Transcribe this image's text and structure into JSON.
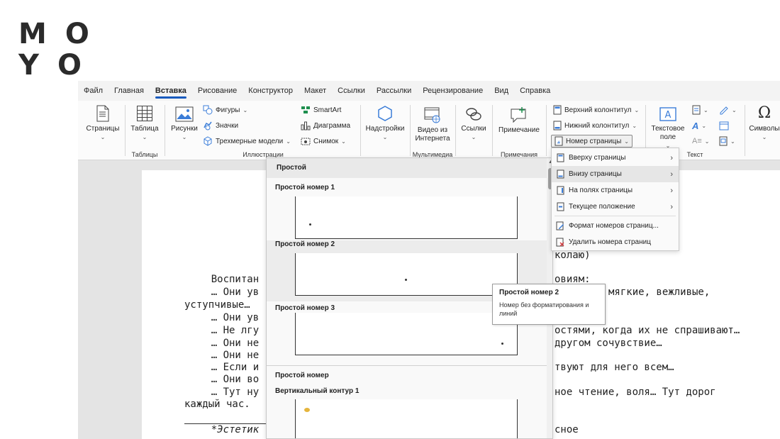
{
  "brand": {
    "row1": [
      "M",
      "O"
    ],
    "row2": [
      "Y",
      "O"
    ]
  },
  "tabs": [
    "Файл",
    "Главная",
    "Вставка",
    "Рисование",
    "Конструктор",
    "Макет",
    "Ссылки",
    "Рассылки",
    "Рецензирование",
    "Вид",
    "Справка"
  ],
  "active_tab": "Вставка",
  "ribbon": {
    "pages": "Страницы",
    "table": "Таблица",
    "tables_group": "Таблицы",
    "pictures": "Рисунки",
    "shapes": "Фигуры",
    "icons": "Значки",
    "models3d": "Трехмерные модели",
    "smartart": "SmartArt",
    "chart": "Диаграмма",
    "screenshot": "Снимок",
    "illustrations_group": "Иллюстрации",
    "addins": "Надстройки",
    "video": "Видео из Интернета",
    "media_group": "Мультимедиа",
    "links": "Ссылки",
    "comment": "Примечание",
    "comments_group": "Примечания",
    "header": "Верхний колонтитул",
    "footer": "Нижний колонтитул",
    "page_number": "Номер страницы",
    "textbox": "Текстовое поле",
    "text_group": "Текст",
    "symbols": "Символы"
  },
  "gallery": {
    "header": "Простой",
    "items": [
      "Простой номер 1",
      "Простой номер 2",
      "Простой номер 3"
    ],
    "section2": "Простой номер",
    "item4": "Вертикальный контур 1"
  },
  "submenu": [
    {
      "label": "Вверху страницы",
      "arrow": true
    },
    {
      "label": "Внизу страницы",
      "arrow": true
    },
    {
      "label": "На полях страницы",
      "arrow": true
    },
    {
      "label": "Текущее положение",
      "arrow": true
    },
    {
      "label": "Формат номеров страниц...",
      "arrow": false
    },
    {
      "label": "Удалить номера страниц",
      "arrow": false
    }
  ],
  "tooltip": {
    "title": "Простой номер 2",
    "desc": "Номер без форматирования и линий"
  },
  "document": {
    "l1": "колаю)",
    "l2": "    Воспитан",
    "l2b": "овиям:",
    "l3": "    … Они ув",
    "l3b": "мягкие, вежливые,",
    "l4": "уступчивые…",
    "l5": "    … Они ув",
    "l6": "    … Не лгу",
    "l6b": "остями, когда их не спрашивают…",
    "l7": "    … Они не",
    "l7b": "другом сочувствие…",
    "l8": "    … Они не",
    "l9": "    … Если и",
    "l9b": "твуют для него всем…",
    "l10": "    … Они во",
    "l11": "    … Тут ну",
    "l11b": "ное чтение, воля… Тут дорог",
    "l12": "каждый час.",
    "l13": "    *Эстетик",
    "l13b": "сное"
  }
}
